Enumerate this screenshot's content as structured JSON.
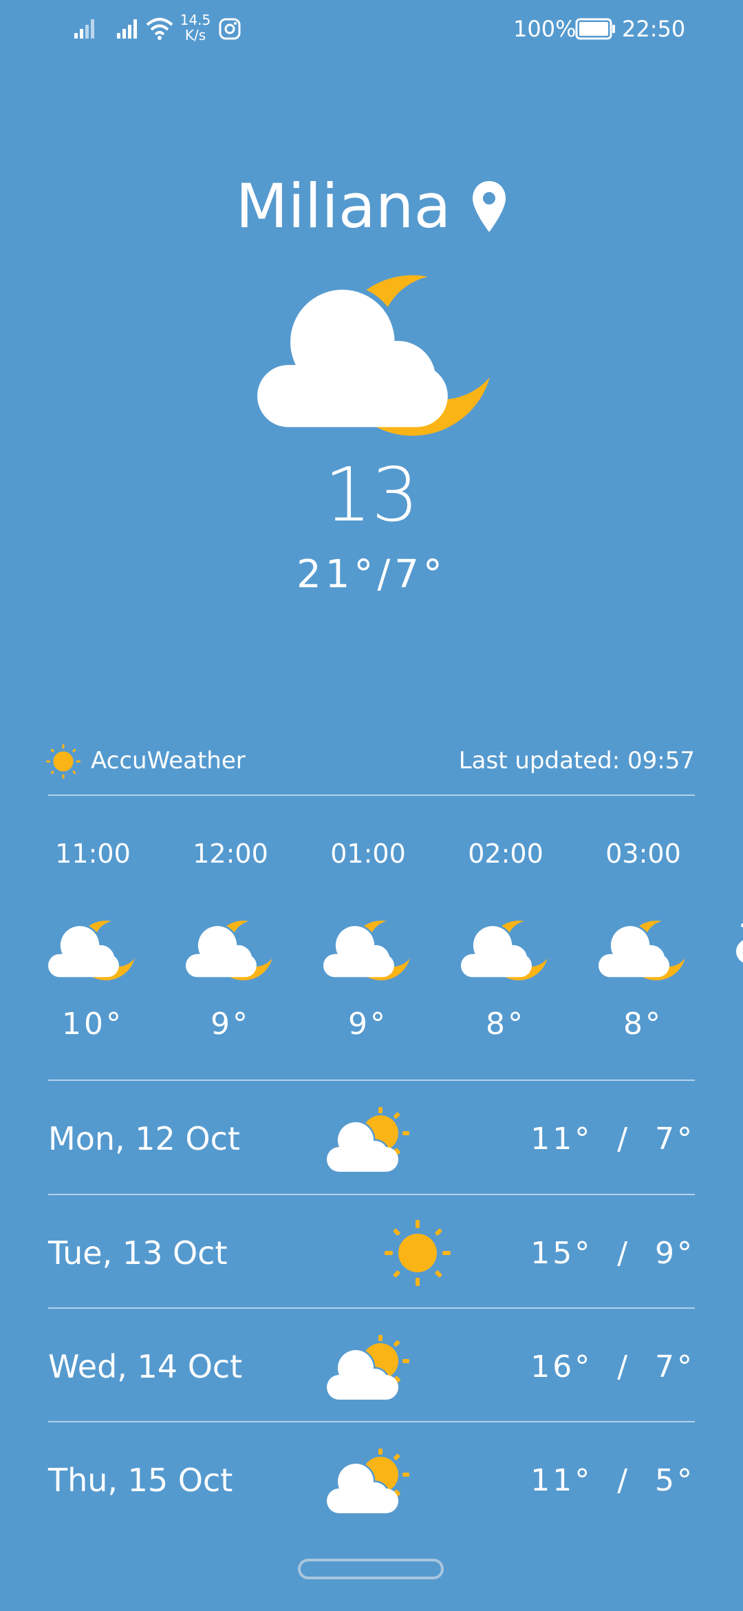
{
  "status_bar": {
    "net_speed_value": "14.5",
    "net_speed_unit": "K/s",
    "battery": "100%",
    "time": "22:50",
    "icons": [
      "signal-icon",
      "signal-icon",
      "wifi-icon",
      "instagram-icon",
      "battery-icon"
    ]
  },
  "location": {
    "city": "Miliana",
    "icon": "location-pin-icon"
  },
  "current": {
    "icon": "cloud-moon-icon",
    "temperature": "13",
    "range": "21°/7°"
  },
  "provider": {
    "icon": "sun-icon",
    "name": "AccuWeather",
    "last_updated": "Last updated: 09:57"
  },
  "hourly": [
    {
      "time": "11:00",
      "icon": "cloud-moon-icon",
      "temp": "10°"
    },
    {
      "time": "12:00",
      "icon": "cloud-moon-icon",
      "temp": "9°"
    },
    {
      "time": "01:00",
      "icon": "cloud-moon-icon",
      "temp": "9°"
    },
    {
      "time": "02:00",
      "icon": "cloud-moon-icon",
      "temp": "8°"
    },
    {
      "time": "03:00",
      "icon": "cloud-moon-icon",
      "temp": "8°"
    }
  ],
  "daily": [
    {
      "date": "Mon, 12 Oct",
      "icon": "cloud-sun-icon",
      "temps": "11°  /  7°"
    },
    {
      "date": "Tue, 13 Oct",
      "icon": "sun-icon",
      "temps": "15°  /  9°"
    },
    {
      "date": "Wed, 14 Oct",
      "icon": "cloud-sun-icon",
      "temps": "16°  /  7°"
    },
    {
      "date": "Thu, 15 Oct",
      "icon": "cloud-sun-icon",
      "temps": "11°  /  5°"
    }
  ],
  "colors": {
    "background": "#559ACF",
    "sun": "#FBB416",
    "cloud": "#FFFFFF"
  }
}
